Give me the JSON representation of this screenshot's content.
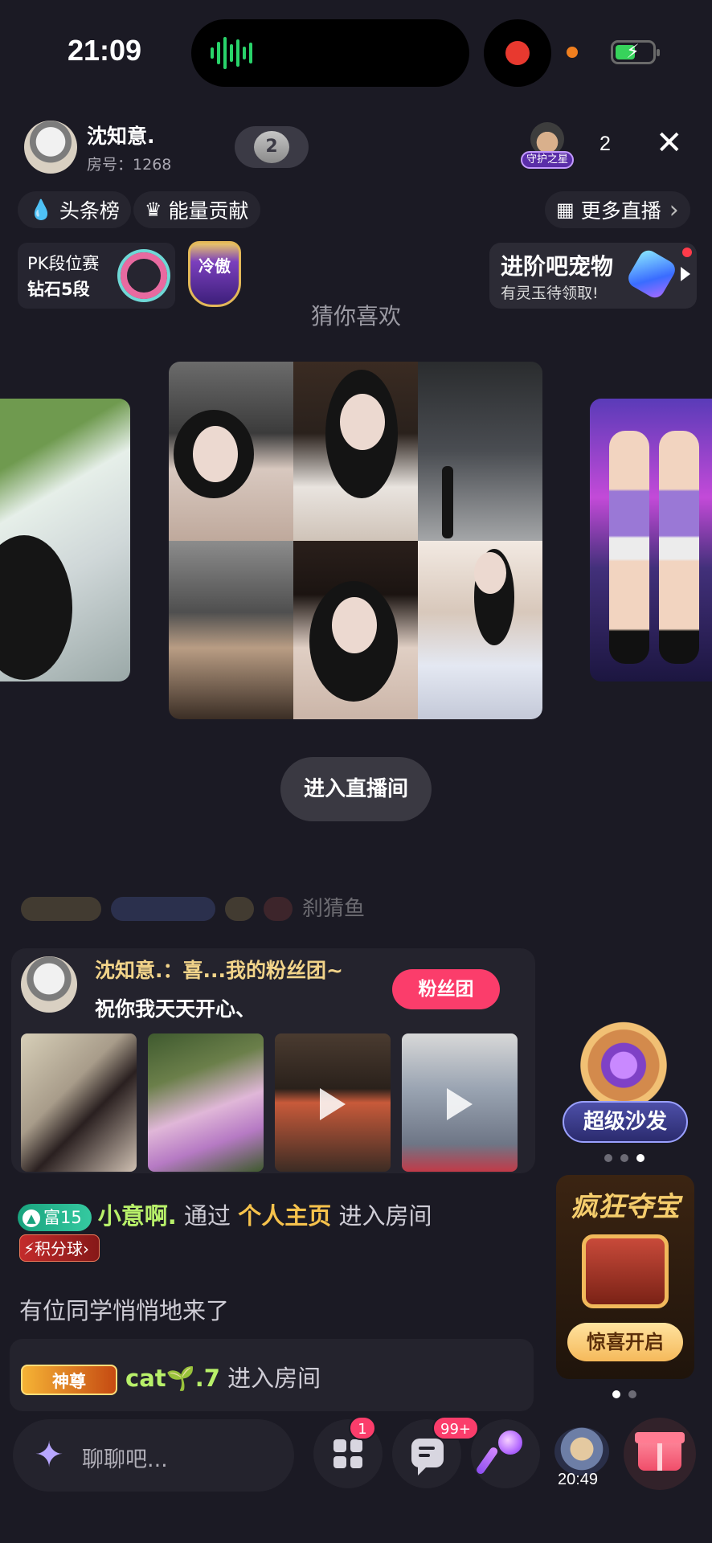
{
  "status_bar": {
    "time": "21:09"
  },
  "host": {
    "name": "沈知意.",
    "room_label": "房号：",
    "room_number": "1268",
    "rank_badge": "2"
  },
  "guard": {
    "label": "守护之星"
  },
  "viewer_count": "2",
  "close_icon": "✕",
  "nav": {
    "headline_rank": "头条榜",
    "energy_contrib": "能量贡献",
    "more_live": "更多直播",
    "chevron": "›"
  },
  "pk": {
    "title": "PK段位赛",
    "tier": "钻石5段",
    "shield_text": "冷傲"
  },
  "promo": {
    "title": "进阶吧宠物",
    "subtitle": "有灵玉待领取!"
  },
  "guess_title": "猜你喜欢",
  "enter_room_button": "进入直播间",
  "ghost_text": "刹猜鱼",
  "fan_message": {
    "line1": "沈知意.：喜...我的粉丝团~",
    "line2": "祝你我天天开心、",
    "button": "粉丝团"
  },
  "super_sofa": {
    "label": "超级沙发"
  },
  "treasure": {
    "title": "疯狂夺宝",
    "button": "惊喜开启"
  },
  "chat": {
    "entry1": {
      "level_badge": "富15",
      "level_icon": "▲",
      "nickname": "小意啊.",
      "via": "通过",
      "source": "个人主页",
      "action": "进入房间"
    },
    "score_badge": "积分球",
    "score_chevron": "›",
    "entry2": "有位同学悄悄地来了",
    "entry3": {
      "badge": "神尊",
      "nickname": "cat🌱.7",
      "action": "进入房间"
    }
  },
  "bottom_bar": {
    "input_placeholder": "聊聊吧...",
    "apps_badge": "1",
    "message_badge": "99+",
    "user_time": "20:49"
  },
  "colors": {
    "background": "#1b1a24",
    "accent_pink": "#fb3d6b",
    "gold": "#f6c24c",
    "green_nick": "#b8f06a"
  },
  "icons": [
    "waveform-icon",
    "record-icon",
    "battery-icon",
    "close-icon",
    "droplet-icon",
    "crown-icon",
    "grid-icon",
    "chevron-right-icon",
    "gem-icon",
    "play-icon",
    "grid-apps-icon",
    "message-icon",
    "microphone-icon",
    "gift-icon"
  ]
}
